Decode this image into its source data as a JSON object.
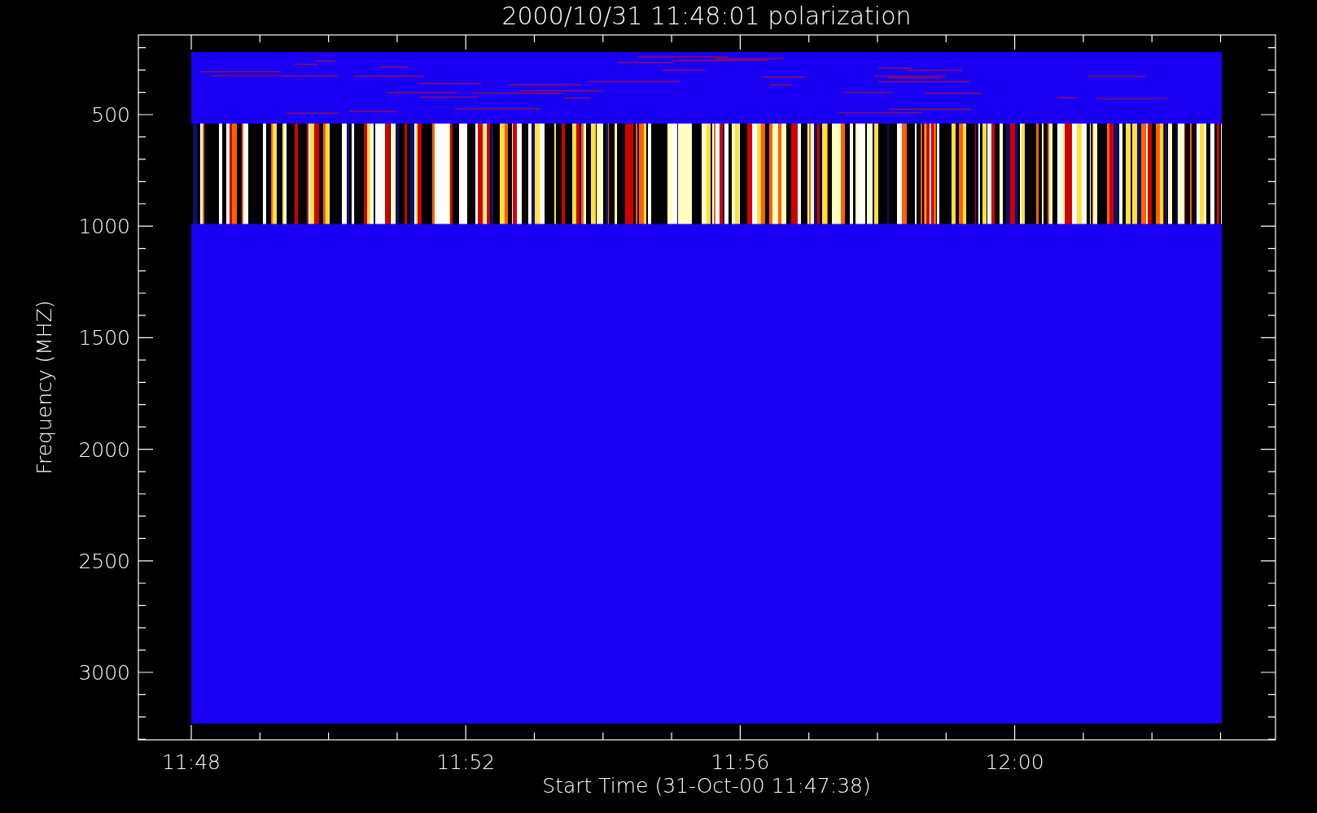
{
  "title": "2000/10/31 11:48:01 polarization",
  "xlabel": "Start Time (31-Oct-00 11:47:38)",
  "ylabel": "Frequency (MHZ)",
  "xticks": [
    "11:48",
    "11:52",
    "11:56",
    "12:00"
  ],
  "yticks": [
    "500",
    "1000",
    "1500",
    "2000",
    "2500",
    "3000"
  ]
}
